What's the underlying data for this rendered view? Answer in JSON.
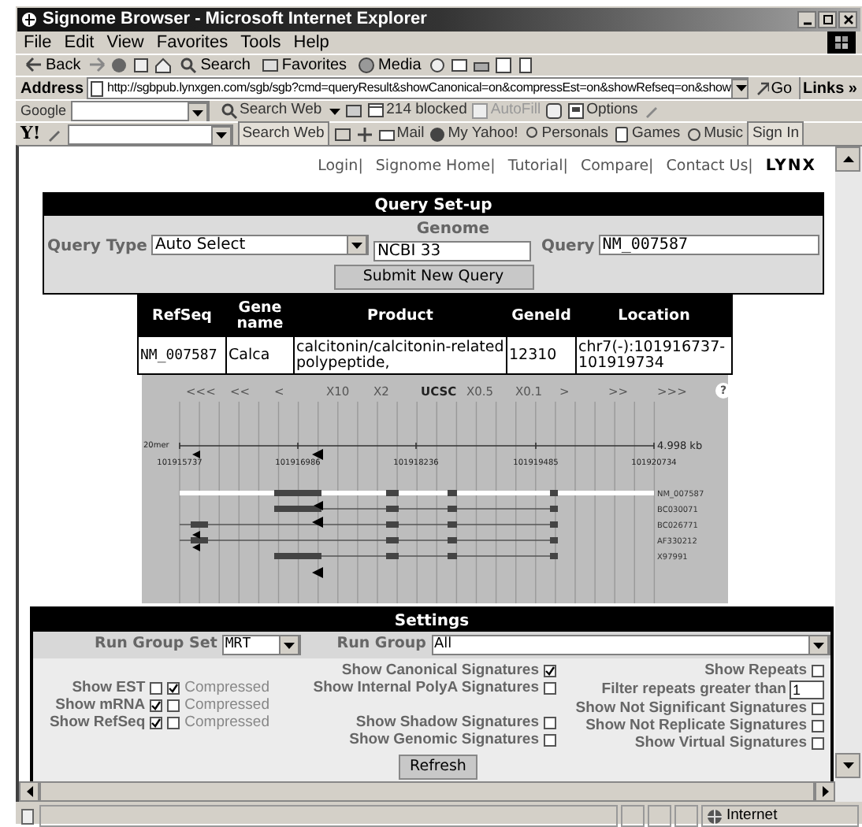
{
  "window": {
    "title": "Signome Browser - Microsoft Internet Explorer"
  },
  "menu": [
    "File",
    "Edit",
    "View",
    "Favorites",
    "Tools",
    "Help"
  ],
  "toolbar": [
    "Back",
    "Search",
    "Favorites",
    "Media"
  ],
  "address": {
    "label": "Address",
    "url": "http://sgbpub.lynxgen.com/sgb/sgb?cmd=queryResult&showCanonical=on&compressEst=on&showRefseq=on&show",
    "go": "Go",
    "links": "Links »"
  },
  "google_bar": {
    "logo": "Google",
    "search": "Search Web",
    "blocked": "214 blocked",
    "autofill": "AutoFill",
    "options": "Options"
  },
  "yahoo_bar": {
    "logo": "Y!",
    "search": "Search Web",
    "items": [
      "Mail",
      "My Yahoo!",
      "Personals",
      "Games",
      "Music"
    ],
    "sign_in": "Sign In"
  },
  "site_links": [
    "Login|",
    "Signome Home|",
    "Tutorial|",
    "Compare|",
    "Contact Us|"
  ],
  "site_logo": "LYNX",
  "query_setup": {
    "title": "Query Set-up",
    "query_type": {
      "label": "Query Type",
      "value": "Auto Select"
    },
    "genome": {
      "label": "Genome",
      "value": "NCBI 33"
    },
    "query": {
      "label": "Query",
      "value": "NM_007587"
    },
    "submit": "Submit New Query"
  },
  "results": {
    "columns": [
      "RefSeq",
      "Gene name",
      "Product",
      "GeneId",
      "Location"
    ],
    "rows": [
      [
        "NM_007587",
        "Calca",
        "calcitonin/calcitonin-related polypeptide,",
        "12310",
        "chr7(-):101916737-101919734"
      ]
    ]
  },
  "genome_view": {
    "nav": [
      "<<<",
      "<<",
      "<",
      "X10",
      "X2",
      "UCSC",
      "X0.5",
      "X0.1",
      ">",
      ">>",
      ">>>",
      "?"
    ],
    "scale_label": "20mer",
    "length": "4.998 kb",
    "positions": [
      "101915737",
      "101916986",
      "101918236",
      "101919485",
      "101920734"
    ],
    "tracks": [
      "NM_007587",
      "BC030071",
      "BC026771",
      "AF330212",
      "X97991"
    ]
  },
  "settings": {
    "title": "Settings",
    "run_group_set": {
      "label": "Run Group Set",
      "value": "MRT"
    },
    "run_group": {
      "label": "Run Group",
      "value": "All"
    },
    "sources": [
      {
        "label": "Show EST",
        "checked": false,
        "compressed_label": "Compressed",
        "compressed": true
      },
      {
        "label": "Show mRNA",
        "checked": true,
        "compressed_label": "Compressed",
        "compressed": false
      },
      {
        "label": "Show RefSeq",
        "checked": true,
        "compressed_label": "Compressed",
        "compressed": false
      }
    ],
    "signatures_top": [
      {
        "label": "Show Canonical Signatures",
        "checked": true
      },
      {
        "label": "Show Internal PolyA Signatures",
        "checked": false
      }
    ],
    "signatures_bottom": [
      {
        "label": "Show Shadow Signatures",
        "checked": false
      },
      {
        "label": "Show Genomic Signatures",
        "checked": false
      }
    ],
    "filters": [
      {
        "kind": "checkbox",
        "label": "Show Repeats",
        "checked": false
      },
      {
        "kind": "field",
        "label": "Filter repeats greater than",
        "value": "1"
      },
      {
        "kind": "checkbox",
        "label": "Show Not Significant Signatures",
        "checked": false
      },
      {
        "kind": "checkbox",
        "label": "Show Not Replicate Signatures",
        "checked": false
      },
      {
        "kind": "checkbox",
        "label": "Show Virtual Signatures",
        "checked": false
      }
    ],
    "refresh": "Refresh"
  },
  "status_bar": {
    "zone": "Internet"
  }
}
